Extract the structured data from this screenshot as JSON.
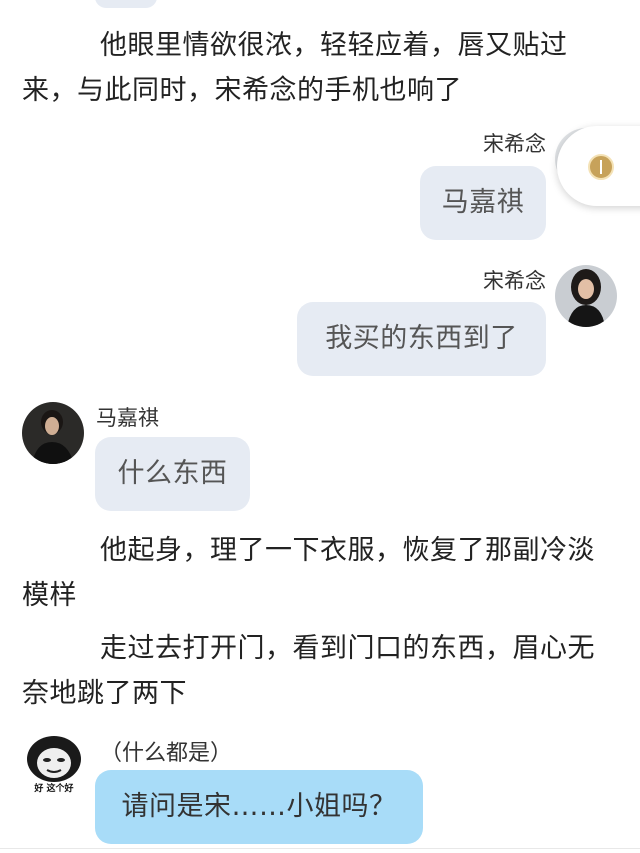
{
  "paragraphs": [
    "他眼里情欲很浓，轻轻应着，唇又贴过来，与此同时，宋希念的手机也响了",
    "他起身，理了一下衣服，恢复了那副冷淡模样",
    "走过去打开门，看到门口的东西，眉心无奈地跳了两下"
  ],
  "messages": [
    {
      "sender": "宋希念",
      "text": "马嘉祺"
    },
    {
      "sender": "宋希念",
      "text": "我买的东西到了"
    },
    {
      "sender": "马嘉祺",
      "text": "什么东西"
    },
    {
      "text": "请问是宋……小姐吗？"
    }
  ],
  "aside": "（什么都是）",
  "meme_caption": "好 这个好",
  "colors": {
    "bubble_gray": "#e6ebf3",
    "bubble_blue": "#a8dcf8"
  }
}
